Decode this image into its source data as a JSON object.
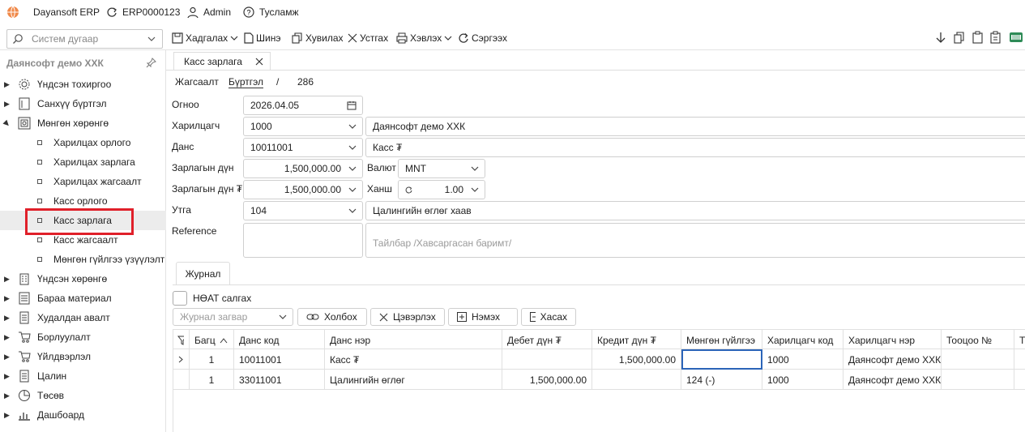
{
  "app": {
    "name": "Dayansoft ERP",
    "erp_id": "ERP0000123",
    "user": "Admin",
    "help": "Тусламж"
  },
  "toolbar": {
    "system_search_placeholder": "Систем дугаар",
    "save": "Хадгалах",
    "new": "Шинэ",
    "copy": "Хувилах",
    "delete": "Устгах",
    "print": "Хэвлэх",
    "refresh": "Сэргээх"
  },
  "sidebar": {
    "title": "Даянсофт демо ХХК",
    "items": [
      {
        "label": "Үндсэн тохиргоо",
        "icon": "gear-icon"
      },
      {
        "label": "Санхүү бүртгэл",
        "icon": "ledger-icon"
      },
      {
        "label": "Мөнгөн хөрөнгө",
        "icon": "money-icon"
      },
      {
        "label": "Харилцах орлого"
      },
      {
        "label": "Харилцах зарлага"
      },
      {
        "label": "Харилцах жагсаалт"
      },
      {
        "label": "Касс орлого"
      },
      {
        "label": "Касс зарлага"
      },
      {
        "label": "Касс жагсаалт"
      },
      {
        "label": "Мөнгөн гүйлгээ үзүүлэлт"
      },
      {
        "label": "Үндсэн хөрөнгө",
        "icon": "building-icon"
      },
      {
        "label": "Бараа материал",
        "icon": "box-icon"
      },
      {
        "label": "Худалдан авалт",
        "icon": "cart-icon"
      },
      {
        "label": "Борлуулалт",
        "icon": "cart-icon"
      },
      {
        "label": "Үйлдвэрлэл",
        "icon": "factory-icon"
      },
      {
        "label": "Цалин",
        "icon": "document-icon"
      },
      {
        "label": "Төсөв",
        "icon": "pie-icon"
      },
      {
        "label": "Дашбоард",
        "icon": "chart-icon"
      }
    ]
  },
  "tab": {
    "title": "Касс зарлага"
  },
  "breadcrumb": {
    "list": "Жагсаалт",
    "register": "Бүртгэл",
    "sep": "/",
    "number": "286"
  },
  "form": {
    "date_label": "Огноо",
    "date_value": "2026.04.05",
    "partner_label": "Харилцагч",
    "partner_code": "1000",
    "partner_name": "Даянсофт демо ХХК",
    "account_label": "Данс",
    "account_code": "10011001",
    "account_name": "Касс ₮",
    "amount_label": "Зарлагын дүн",
    "amount_value": "1,500,000.00",
    "currency_label": "Валют",
    "currency_value": "MNT",
    "amount_mnt_label": "Зарлагын дүн ₮",
    "amount_mnt_value": "1,500,000.00",
    "rate_label": "Ханш",
    "rate_value": "1.00",
    "purpose_label": "Утга",
    "purpose_code": "104",
    "purpose_name": "Цалингийн өглөг хаав",
    "reference_label": "Reference",
    "note_placeholder": "Тайлбар /Хавсаргасан баримт/"
  },
  "journal": {
    "tab": "Журнал",
    "vat_label": "НӨАТ салгах",
    "template_placeholder": "Журнал загвар",
    "link": "Холбох",
    "clear": "Цэвэрлэх",
    "add": "Нэмэх",
    "remove": "Хасах",
    "columns": [
      "Багц",
      "Данс код",
      "Данс нэр",
      "Дебет дүн ₮",
      "Кредит дүн ₮",
      "Мөнгөн гүйлгээ",
      "Харилцагч код",
      "Харилцагч нэр",
      "Тооцоо №",
      "Т"
    ],
    "rows": [
      {
        "batch": "1",
        "code": "10011001",
        "name": "Касс ₮",
        "debit": "",
        "credit": "1,500,000.00",
        "cash": "",
        "pcode": "1000",
        "pname": "Даянсофт демо ХХК",
        "calc": ""
      },
      {
        "batch": "1",
        "code": "33011001",
        "name": "Цалингийн өглөг",
        "debit": "1,500,000.00",
        "credit": "",
        "cash": "124 (-)",
        "pcode": "1000",
        "pname": "Даянсофт демо ХХК",
        "calc": ""
      }
    ]
  }
}
